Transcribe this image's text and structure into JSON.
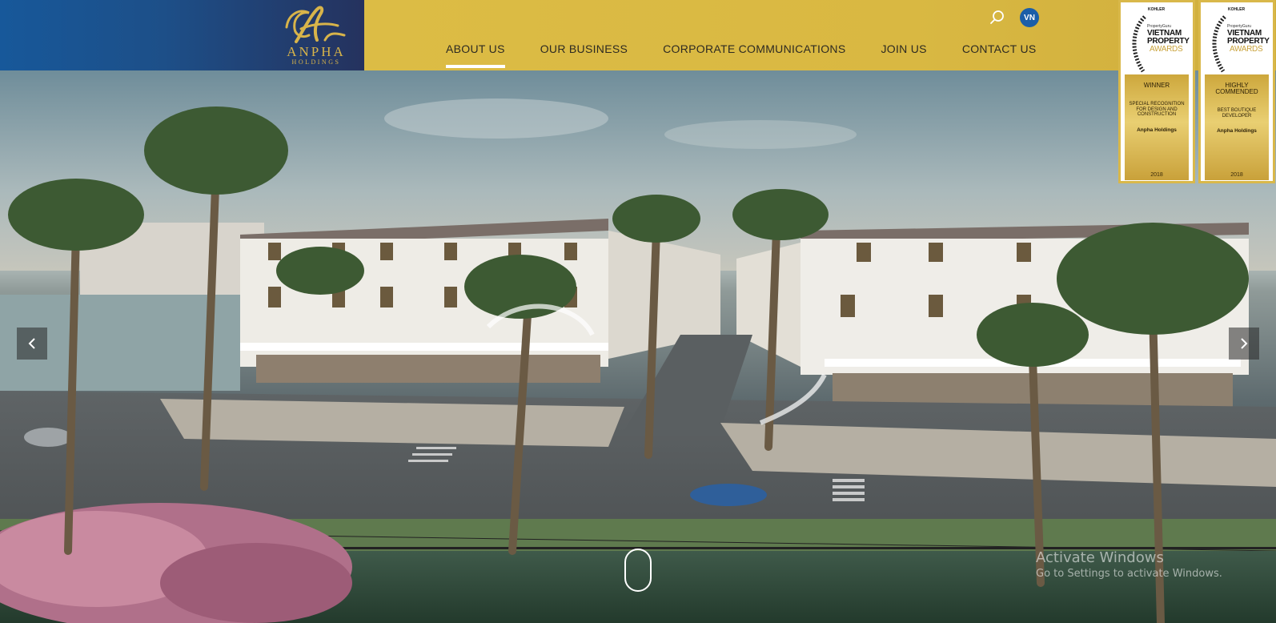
{
  "brand": {
    "name": "ANPHA",
    "subtitle": "HOLDINGS",
    "colors": {
      "primary_blue": "#17589a",
      "gold": "#dcbc45",
      "logo_gold": "#d8b44a"
    }
  },
  "nav": {
    "items": [
      {
        "label": "ABOUT US",
        "active": true
      },
      {
        "label": "OUR BUSINESS",
        "active": false
      },
      {
        "label": "CORPORATE COMMUNICATIONS",
        "active": false
      },
      {
        "label": "JOIN US",
        "active": false
      },
      {
        "label": "CONTACT US",
        "active": false
      }
    ],
    "search_icon": "search-icon",
    "language": "VN"
  },
  "hero": {
    "prev_icon": "chevron-left-icon",
    "next_icon": "chevron-right-icon",
    "scroll_icon": "mouse-scroll-icon"
  },
  "awards": [
    {
      "sponsor": "KOHLER",
      "sponsor_note": "presents",
      "organizer": "PropertyGuru",
      "program": "VIETNAM PROPERTY",
      "program_sub": "AWARDS",
      "rank": "WINNER",
      "category": "SPECIAL RECOGNITION FOR DESIGN AND CONSTRUCTION",
      "recipient": "Anpha Holdings",
      "year": "2018"
    },
    {
      "sponsor": "KOHLER",
      "sponsor_note": "presents",
      "organizer": "PropertyGuru",
      "program": "VIETNAM PROPERTY",
      "program_sub": "AWARDS",
      "rank": "HIGHLY COMMENDED",
      "category": "BEST BOUTIQUE DEVELOPER",
      "recipient": "Anpha Holdings",
      "year": "2018"
    }
  ],
  "os_watermark": {
    "title": "Activate Windows",
    "subtitle": "Go to Settings to activate Windows."
  }
}
